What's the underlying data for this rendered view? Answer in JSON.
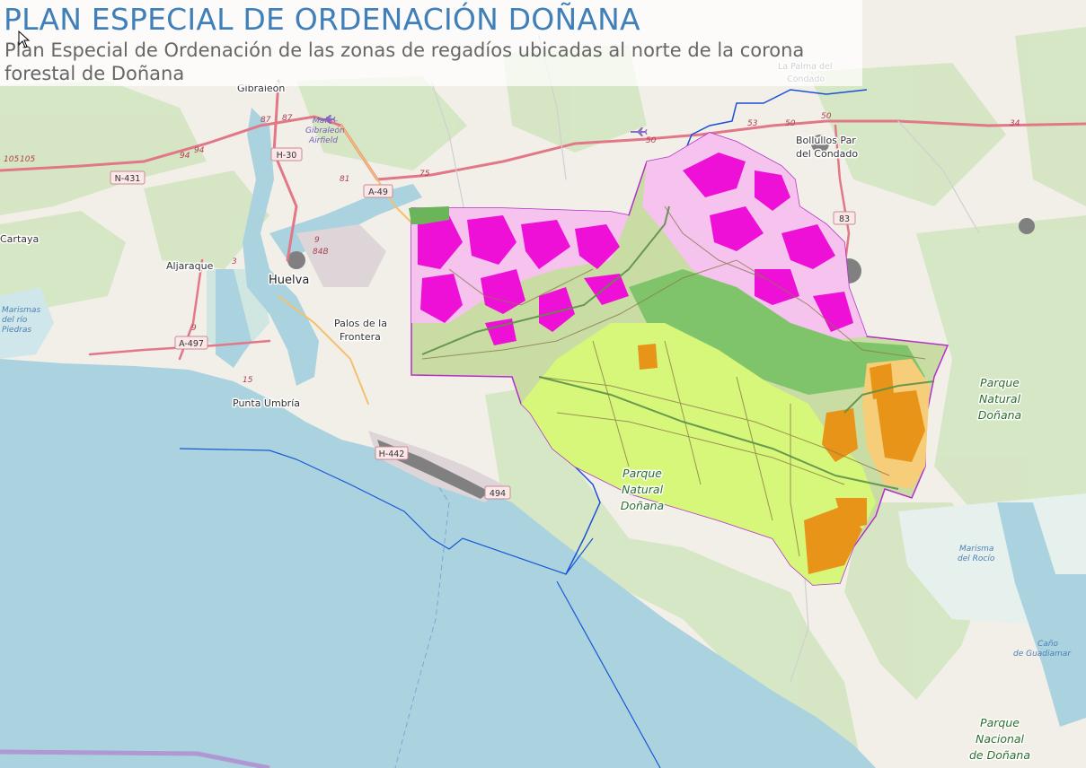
{
  "header": {
    "title": "PLAN ESPECIAL DE ORDENACIÓN DOÑANA",
    "subtitle": "Plan Especial de Ordenación de las zonas de regadíos ubicadas al norte de la corona forestal de Doñana"
  },
  "colors": {
    "sea": "#aad3df",
    "land": "#f2efe9",
    "woodland": "#d3e6c1",
    "park_green": "#c5e0b0",
    "plan_boundary": "#b42ec8",
    "irrigation_magenta": "#ee10d6",
    "irrigation_pink": "#f6c2ee",
    "forest_yellow_green": "#d7f77a",
    "crop_green": "#a8d68a",
    "dark_green": "#7fc46a",
    "orange": "#e79418",
    "light_orange": "#f6cd78",
    "road_red": "#e07a8a",
    "river_blue": "#1a4fd8"
  },
  "places": {
    "huelva": "Huelva",
    "gibraleon": "Gibraleón",
    "cartaya": "Cartaya",
    "aljaraque": "Aljaraque",
    "palos": "Palos de la Frontera",
    "punta_umbria": "Punta Umbría",
    "bollullos": "Bollullos Par del Condado",
    "la_palma": "La Palma del Condado",
    "airfield": "Mafé - Gibraleón Airfield"
  },
  "parks": {
    "natural_east": "Parque Natural Doñana",
    "natural_center": "Parque Natural Doñana",
    "nacional": "Parque Nacional de Doñana"
  },
  "water": {
    "marismas_rio": "Marismas del río Piedras",
    "marisma_rocio": "Marisma del Rocío",
    "cano": "Caño de Guadiamar"
  },
  "roads": {
    "n431": "N-431",
    "h30": "H-30",
    "a49": "A-49",
    "a497": "A-497",
    "a83": "83",
    "h442": "H-442",
    "a494": "494",
    "n87a": "87",
    "n87b": "87",
    "n94a": "94",
    "n94b": "94",
    "n105a": "105",
    "n105b": "105",
    "n81": "81",
    "n75": "75",
    "n9": "9",
    "n84b": "84B",
    "n3": "3",
    "n9b": "9",
    "n15": "15",
    "n50a": "50",
    "n53": "53",
    "n50b": "50",
    "n50c": "50",
    "n34": "34"
  }
}
